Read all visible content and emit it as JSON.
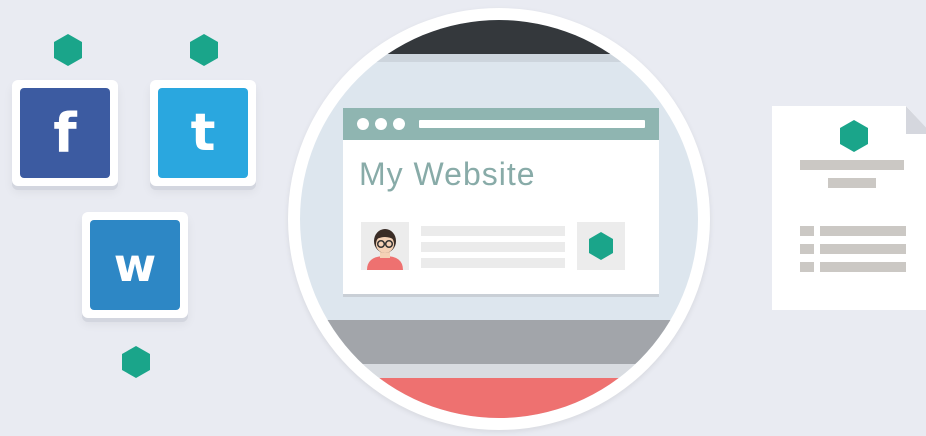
{
  "social": {
    "facebook_letter": "f",
    "twitter_letter": "t",
    "wordpress_letter": "w"
  },
  "browser": {
    "site_title": "My Website"
  },
  "colors": {
    "background": "#e9ebf2",
    "hex_accent": "#1aa58a",
    "facebook": "#3c5ba1",
    "twitter": "#2aa7df",
    "wordpress": "#2d87c5",
    "browser_bar": "#8fb5b1",
    "title_text": "#88aba8",
    "desk_red": "#ee7170"
  },
  "icons": [
    "hexagon-icon",
    "facebook-icon",
    "twitter-icon",
    "wordpress-icon",
    "avatar-icon",
    "document-icon"
  ]
}
